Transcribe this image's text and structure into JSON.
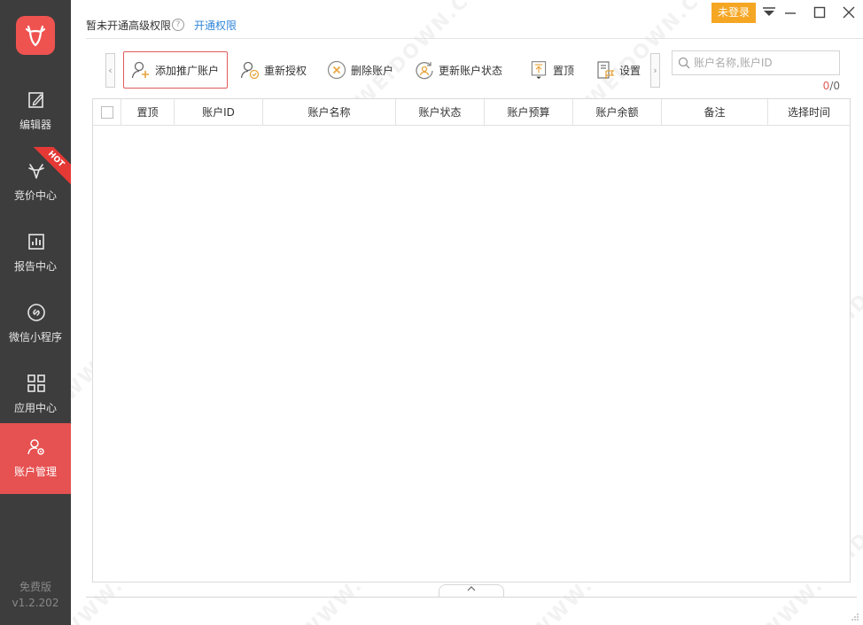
{
  "colors": {
    "accent": "#e65151",
    "sidebar_bg": "#3d3d3d",
    "link": "#2f86d9",
    "login_bg": "#f5a623"
  },
  "header": {
    "permission_text": "暂未开通高级权限",
    "help_icon": "?",
    "permission_link": "开通权限",
    "login_label": "未登录"
  },
  "sidebar": {
    "items": [
      {
        "label": "编辑器",
        "icon": "edit-icon"
      },
      {
        "label": "竞价中心",
        "icon": "antler-icon",
        "badge": "HOT"
      },
      {
        "label": "报告中心",
        "icon": "chart-icon"
      },
      {
        "label": "微信小程序",
        "icon": "link-circle-icon"
      },
      {
        "label": "应用中心",
        "icon": "grid-icon"
      },
      {
        "label": "账户管理",
        "icon": "user-gear-icon",
        "active": true
      }
    ],
    "edition": "免费版",
    "version": "v1.2.202"
  },
  "toolbar": {
    "prev": "‹",
    "next": "›",
    "add_account": "添加推广账户",
    "reauthorize": "重新授权",
    "delete_account": "删除账户",
    "update_status": "更新账户状态",
    "pin_top": "置顶",
    "settings": "设置"
  },
  "search": {
    "placeholder": "账户名称,账户ID",
    "value": ""
  },
  "counter": {
    "current": "0",
    "total": "/0"
  },
  "table": {
    "columns": [
      "置顶",
      "账户ID",
      "账户名称",
      "账户状态",
      "账户预算",
      "账户余额",
      "备注",
      "选择时间"
    ],
    "rows": []
  },
  "watermark": "WWW.WEIDOWN.COM"
}
